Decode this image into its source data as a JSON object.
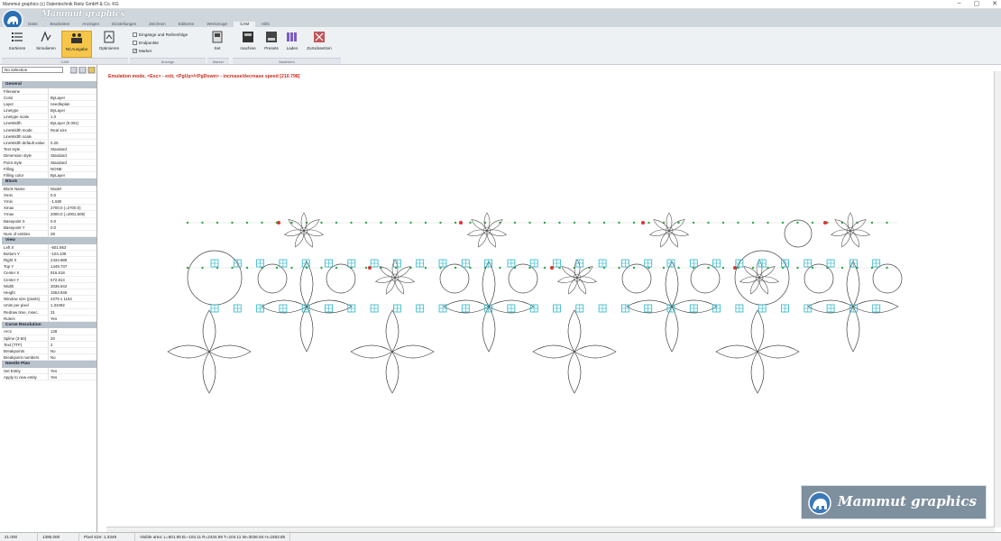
{
  "window": {
    "title": "Mammut graphics (c) Datentechnik Reitz GmbH & Co. KG"
  },
  "brand": {
    "name": "Mammut graphics"
  },
  "menu_tabs": [
    {
      "label": "Datei"
    },
    {
      "label": "Bearbeiten"
    },
    {
      "label": "Anzeigen"
    },
    {
      "label": "Einstellungen"
    },
    {
      "label": "Zeichnen"
    },
    {
      "label": "Editieren"
    },
    {
      "label": "Werkzeuge"
    },
    {
      "label": "CAM"
    },
    {
      "label": "Hilfe"
    }
  ],
  "ribbon": {
    "cam_buttons": [
      {
        "label": "Sortieren",
        "icon": "list-icon"
      },
      {
        "label": "Simulieren",
        "icon": "simulate-icon"
      },
      {
        "label": "NCAusgabe",
        "icon": "nc-output-icon"
      },
      {
        "label": "Optimieren",
        "icon": "optimize-icon"
      }
    ],
    "checkboxes": [
      {
        "label": "Eingänge und Reihenfolge",
        "checked": false
      },
      {
        "label": "Endpunkte",
        "checked": false
      },
      {
        "label": "Marker",
        "checked": true
      }
    ],
    "marker_button": {
      "label": "Set"
    },
    "nadelzien_buttons": [
      {
        "label": "machine"
      },
      {
        "label": "Presets"
      },
      {
        "label": "Laden"
      },
      {
        "label": "Zurücksetzen"
      }
    ],
    "groups": [
      "CAM",
      "Anzeige",
      "Marker",
      "Nadelzien"
    ]
  },
  "selection": {
    "value": "No selection"
  },
  "properties": {
    "general": {
      "title": "General",
      "rows": [
        {
          "k": "Filename",
          "v": ""
        },
        {
          "k": "Color",
          "v": "ByLayer"
        },
        {
          "k": "Layer",
          "v": "needleplan"
        },
        {
          "k": "Linetype",
          "v": "ByLayer"
        },
        {
          "k": "Linetype scale",
          "v": "1.0"
        },
        {
          "k": "LineWidth",
          "v": "ByLayer (0.001)"
        },
        {
          "k": "LineWidth mode",
          "v": "Real size"
        },
        {
          "k": "LineWidth scale",
          "v": ""
        },
        {
          "k": "LineWidth default value",
          "v": "0.25"
        },
        {
          "k": "Text style",
          "v": "Standard"
        },
        {
          "k": "Dimension style",
          "v": "Standard"
        },
        {
          "k": "Point style",
          "v": "Standard"
        },
        {
          "k": "Filling",
          "v": "NONE"
        },
        {
          "k": "Filling color",
          "v": "ByLayer"
        }
      ]
    },
    "block": {
      "title": "Block",
      "rows": [
        {
          "k": "Block Name",
          "v": "Model"
        },
        {
          "k": "Xmin",
          "v": "0.0"
        },
        {
          "k": "Ymin",
          "v": "-1.509"
        },
        {
          "k": "Xmax",
          "v": "2700.0  (=2700.0)"
        },
        {
          "k": "Ymax",
          "v": "2000.0  (=2001.509)"
        },
        {
          "k": "Basepoint X",
          "v": "0.0"
        },
        {
          "k": "Basepoint Y",
          "v": "0.0"
        },
        {
          "k": "Num of entities",
          "v": "39"
        }
      ]
    },
    "view": {
      "title": "View",
      "rows": [
        {
          "k": "Left X",
          "v": "-601.953"
        },
        {
          "k": "Bottom Y",
          "v": "-104.109"
        },
        {
          "k": "Right X",
          "v": "2434.989"
        },
        {
          "k": "Top Y",
          "v": "1449.737"
        },
        {
          "k": "Center X",
          "v": "916.518"
        },
        {
          "k": "Center Y",
          "v": "672.814"
        },
        {
          "k": "Width",
          "v": "3036.942"
        },
        {
          "k": "Height",
          "v": "1553.846"
        },
        {
          "k": "Window size (pixels)",
          "v": "2276 x 1164"
        },
        {
          "k": "Units per pixel",
          "v": "1.33492"
        },
        {
          "k": "Redraw time, msec.",
          "v": "31"
        },
        {
          "k": "Rulers",
          "v": "Yes"
        }
      ]
    },
    "curve": {
      "title": "Curve Resolution",
      "rows": [
        {
          "k": "Arcs",
          "v": "128"
        },
        {
          "k": "Spline (3-50)",
          "v": "20"
        },
        {
          "k": "Text (TTF)",
          "v": "3"
        },
        {
          "k": "Breakpoints",
          "v": "No"
        },
        {
          "k": "Breakpoint numbers",
          "v": "No"
        }
      ]
    },
    "needle": {
      "title": "Needle Plan",
      "rows": [
        {
          "k": "Set Entity",
          "v": "Yes"
        },
        {
          "k": "Apply to new entity",
          "v": "Yes"
        }
      ]
    }
  },
  "ruler": {
    "ticks": [
      "-500",
      "-400",
      "-300",
      "-200",
      "-100",
      "0",
      "100",
      "200",
      "300",
      "400",
      "500",
      "600",
      "700",
      "800",
      "900",
      "1000",
      "1100",
      "1200",
      "1300",
      "1400",
      "1500",
      "1600",
      "1700",
      "1800",
      "1900",
      "2000",
      "2100",
      "2200",
      "2300",
      "2400"
    ]
  },
  "vruler": {
    "ticks": [
      "1400",
      "1300",
      "1200",
      "1100",
      "1000",
      "900",
      "800",
      "700",
      "600",
      "500",
      "400",
      "300",
      "200",
      "100"
    ]
  },
  "canvas": {
    "message": "Emulation mode, <Esc> - exit, <PgUp>/<PgDown> - increase/decrease speed [210.798]"
  },
  "status": {
    "x": "21.000",
    "y": "1396.000",
    "pixel_size": "Pixel size: 1.3349",
    "visible_area": "Visible area:  L=601.95  B=-104.11  R=2434.99  T=104.11  W=3036.94  H=1553.85"
  },
  "colors": {
    "accent": "#f5c64a",
    "emulation_text": "#cc2a1a",
    "marker_cyan": "#27b5c9",
    "point_green": "#2ea84a",
    "point_red": "#e03030"
  }
}
